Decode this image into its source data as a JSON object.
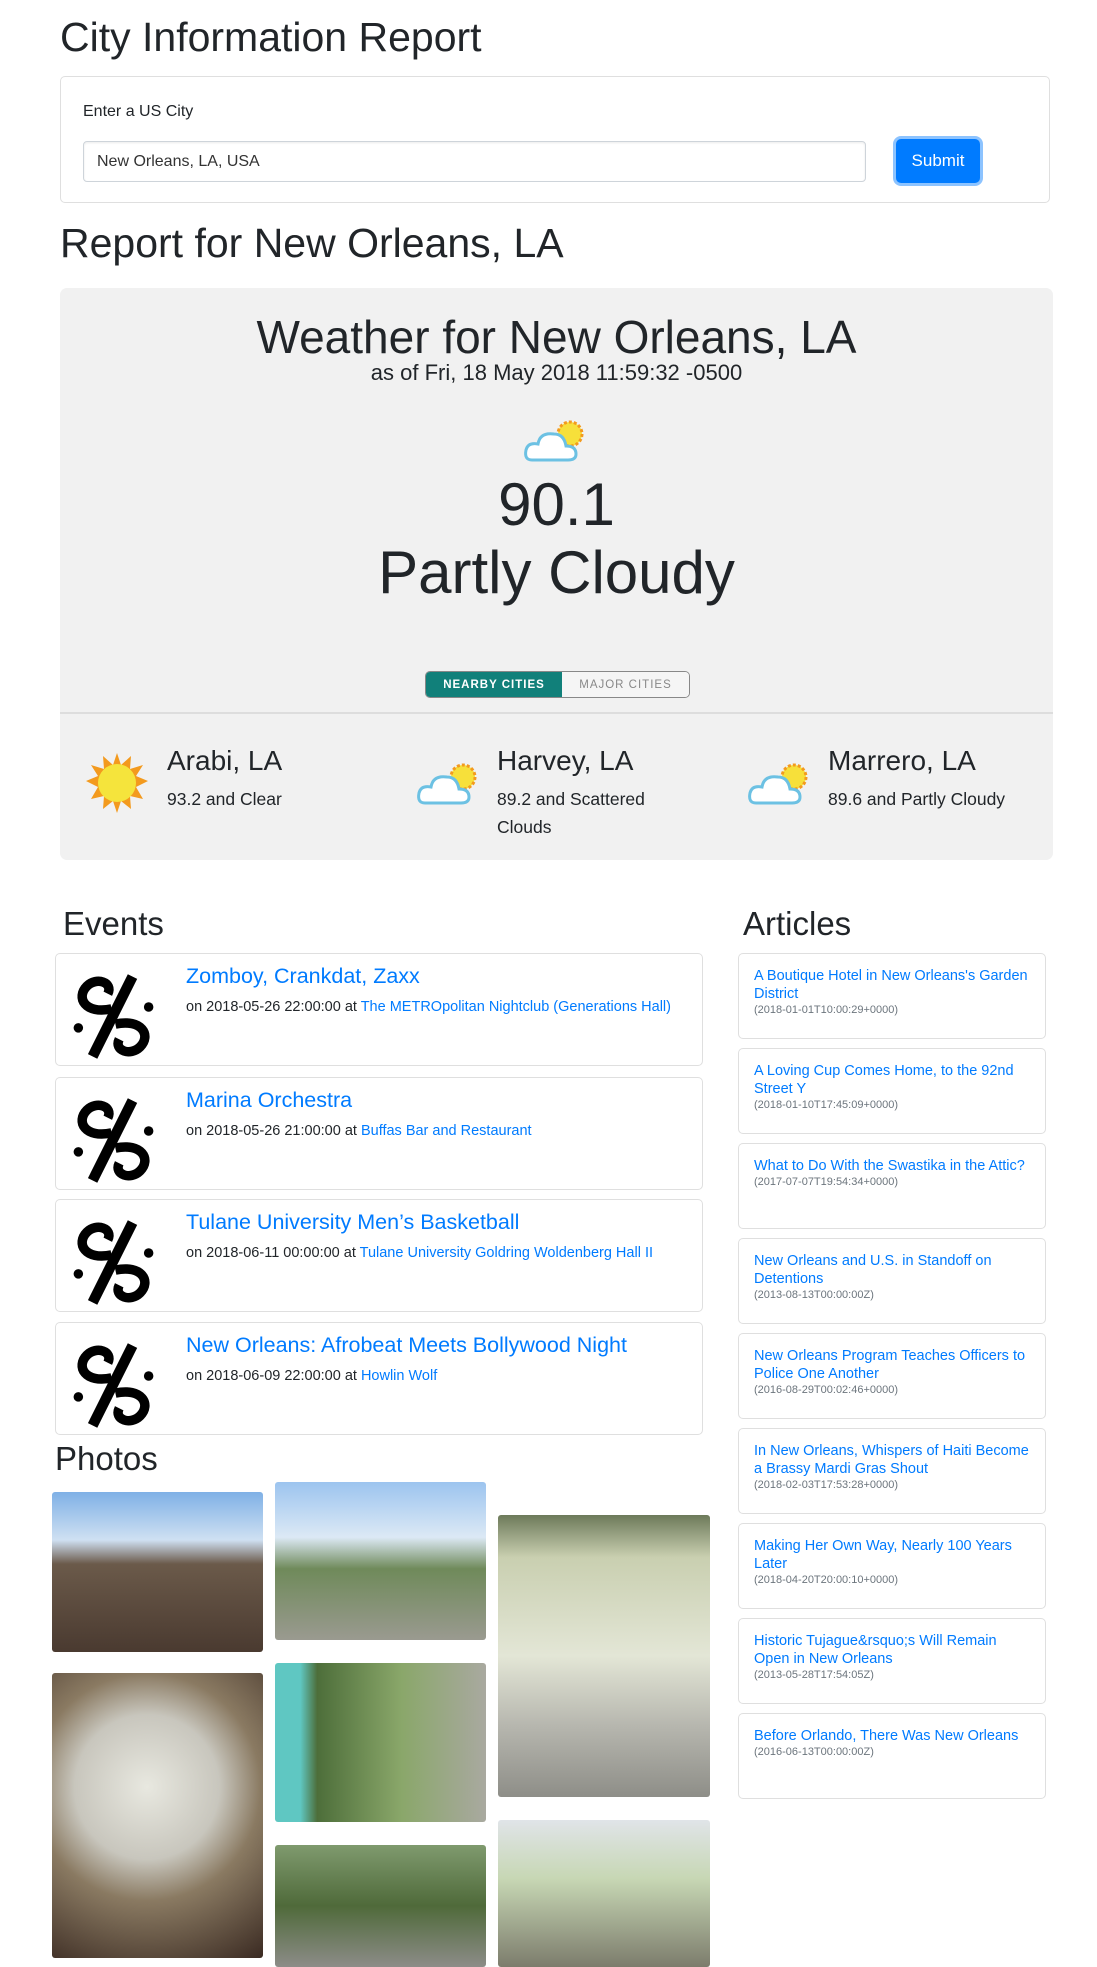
{
  "header": {
    "title": "City Information Report"
  },
  "form": {
    "label": "Enter a US City",
    "input_value": "New Orleans, LA, USA",
    "submit_label": "Submit"
  },
  "report": {
    "title": "Report for New Orleans, LA"
  },
  "weather": {
    "title": "Weather for New Orleans, LA",
    "as_of": "as of Fri, 18 May 2018 11:59:32 -0500",
    "icon": "partly-cloudy-icon",
    "temperature": "90.1",
    "condition": "Partly Cloudy",
    "toggle": {
      "active": "NEARBY CITIES",
      "inactive": "MAJOR CITIES",
      "active_color": "#11807a"
    },
    "nearby": [
      {
        "name": "Arabi, LA",
        "desc": "93.2 and Clear",
        "icon": "sun-icon"
      },
      {
        "name": "Harvey, LA",
        "desc": "89.2 and Scattered Clouds",
        "icon": "partly-cloudy-icon"
      },
      {
        "name": "Marrero, LA",
        "desc": "89.6 and Partly Cloudy",
        "icon": "partly-cloudy-icon"
      }
    ]
  },
  "events": {
    "heading": "Events",
    "items": [
      {
        "title": "Zomboy, Crankdat, Zaxx",
        "when": "on 2018-05-26 22:00:00 at",
        "venue": "The METROpolitan Nightclub (Generations Hall)"
      },
      {
        "title": "Marina Orchestra",
        "when": "on 2018-05-26 21:00:00 at",
        "venue": "Buffas Bar and Restaurant"
      },
      {
        "title": "Tulane University Men’s Basketball",
        "when": "on 2018-06-11 00:00:00 at",
        "venue": "Tulane University Goldring Woldenberg Hall II"
      },
      {
        "title": "New Orleans: Afrobeat Meets Bollywood Night",
        "when": "on 2018-06-09 22:00:00 at",
        "venue": "Howlin Wolf"
      }
    ]
  },
  "articles": {
    "heading": "Articles",
    "items": [
      {
        "title": "A Boutique Hotel in New Orleans's Garden District",
        "date": "(2018-01-01T10:00:29+0000)"
      },
      {
        "title": "A Loving Cup Comes Home, to the 92nd Street Y",
        "date": "(2018-01-10T17:45:09+0000)"
      },
      {
        "title": "What to Do With the Swastika in the Attic?",
        "date": "(2017-07-07T19:54:34+0000)"
      },
      {
        "title": "New Orleans and U.S. in Standoff on Detentions",
        "date": "(2013-08-13T00:00:00Z)"
      },
      {
        "title": "New Orleans Program Teaches Officers to Police One Another",
        "date": "(2016-08-29T00:02:46+0000)"
      },
      {
        "title": "In New Orleans, Whispers of Haiti Become a Brassy Mardi Gras Shout",
        "date": "(2018-02-03T17:53:28+0000)"
      },
      {
        "title": "Making Her Own Way, Nearly 100 Years Later",
        "date": "(2018-04-20T20:00:10+0000)"
      },
      {
        "title": "Historic Tujague&rsquo;s Will Remain Open in New Orleans",
        "date": "(2013-05-28T17:54:05Z)"
      },
      {
        "title": "Before Orlando, There Was New Orleans",
        "date": "(2016-06-13T00:00:00Z)"
      }
    ]
  },
  "photos": {
    "heading": "Photos"
  }
}
